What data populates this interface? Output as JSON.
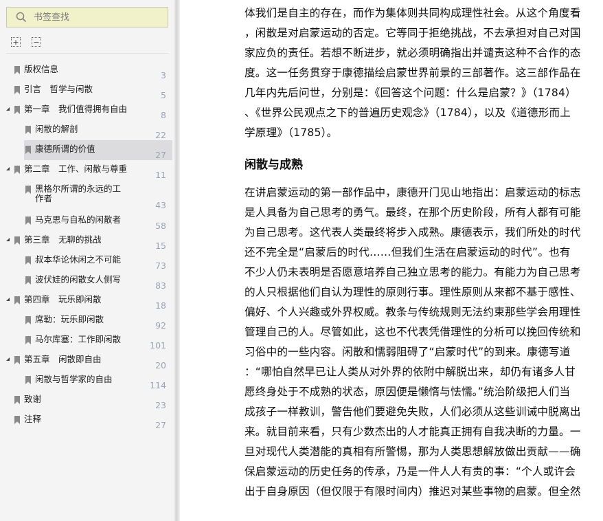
{
  "sidebar": {
    "search_placeholder": "书签查找",
    "expand_all": "+",
    "collapse_all": "−",
    "items": [
      {
        "label": "版权信息",
        "page": "3",
        "level": 0,
        "expandable": false
      },
      {
        "label": "引言　哲学与闲散",
        "page": "5",
        "level": 0,
        "expandable": false
      },
      {
        "label": "第一章　我们值得拥有自由",
        "page": "8",
        "level": 0,
        "expandable": true
      },
      {
        "label": "闲散的解剖",
        "page": "22",
        "level": 1
      },
      {
        "label": "康德所谓的价值",
        "page": "27",
        "level": 1,
        "selected": true
      },
      {
        "label": "第二章　工作、闲散与尊重",
        "page": "11",
        "level": 0,
        "expandable": true
      },
      {
        "label": "黑格尔所谓的永远的工",
        "label2": "作者",
        "page": "43",
        "level": 1
      },
      {
        "label": "马克思与自私的闲散者",
        "page": "58",
        "level": 1
      },
      {
        "label": "第三章　无聊的挑战",
        "page": "15",
        "level": 0,
        "expandable": true
      },
      {
        "label": "叔本华论休闲之不可能",
        "page": "73",
        "level": 1
      },
      {
        "label": "波伏娃的闲散女人侧写",
        "page": "83",
        "level": 1
      },
      {
        "label": "第四章　玩乐即闲散",
        "page": "18",
        "level": 0,
        "expandable": true
      },
      {
        "label": "席勒：玩乐即闲散",
        "page": "92",
        "level": 1
      },
      {
        "label": "马尔库塞：工作即闲散",
        "page": "101",
        "level": 1
      },
      {
        "label": "第五章　闲散即自由",
        "page": "20",
        "level": 0,
        "expandable": true
      },
      {
        "label": "闲散与哲学家的自由",
        "page": "114",
        "level": 1
      },
      {
        "label": "致谢",
        "page": "23",
        "level": 0,
        "expandable": false
      },
      {
        "label": "注释",
        "page": "27",
        "level": 0,
        "expandable": false
      }
    ]
  },
  "content": {
    "para1": [
      "体我们是自主的存在，而作为集体则共同构成理性社会。从这个角度看",
      "，闲散是对启蒙运动的否定。它等同于拒绝挑战，不去承担对自己对国",
      "家应负的责任。若想不断进步，就必须明确指出并谴责这种不合作的态",
      "度。这一任务贯穿于康德描绘启蒙世界前景的三部著作。这三部作品在",
      "几年内先后问世，分别是：《回答这个问题：什么是启蒙？》（1784）",
      "、《世界公民观点之下的普遍历史观念》（1784），以及《道德形而上",
      "学原理》（1785）。"
    ],
    "heading": "闲散与成熟",
    "para2": [
      "在讲启蒙运动的第一部作品中，康德开门见山地指出：启蒙运动的标志",
      "是人具备为自己思考的勇气。最终，在那个历史阶段，所有人都有可能",
      "为自己思考。这代表人类最终将步入成熟。康德表示，我们所处的时代",
      "还不完全是“启蒙后的时代……但我们生活在启蒙运动的时代”。也有",
      "不少人仍未表明是否愿意培养自己独立思考的能力。有能力为自己思考",
      "的人只根据他们自认为理性的原则行事。理性原则从来都不基于感性、",
      "偏好、个人兴趣或外界权威。教条与传统规则无法约束那些学会用理性",
      "管理自己的人。尽管如此，这也不代表凭借理性的分析可以挽回传统和",
      "习俗中的一些内容。闲散和懦弱阻碍了“启蒙时代”的到来。康德写道",
      "：“哪怕自然早已让人类从对外界的依附中解脱出来，却仍有诸多人甘",
      "愿终身处于不成熟的状态，原因便是懒惰与怯懦。”统治阶级把人们当",
      "成孩子一样教训，警告他们要避免失败，人们必须从这些训诫中脱离出",
      "来。就目前来看，只有少数杰出的人才能真正拥有自我决断的力量。一",
      "旦对现代人类潜能的真相有所警惕，那为人类思想解放做出贡献——确",
      "保启蒙运动的历史任务的传承，乃是一件人人有责的事：“个人或许会",
      "出于自身原因（但仅限于有限时间内）推迟对某些事物的启蒙。但全然"
    ]
  }
}
